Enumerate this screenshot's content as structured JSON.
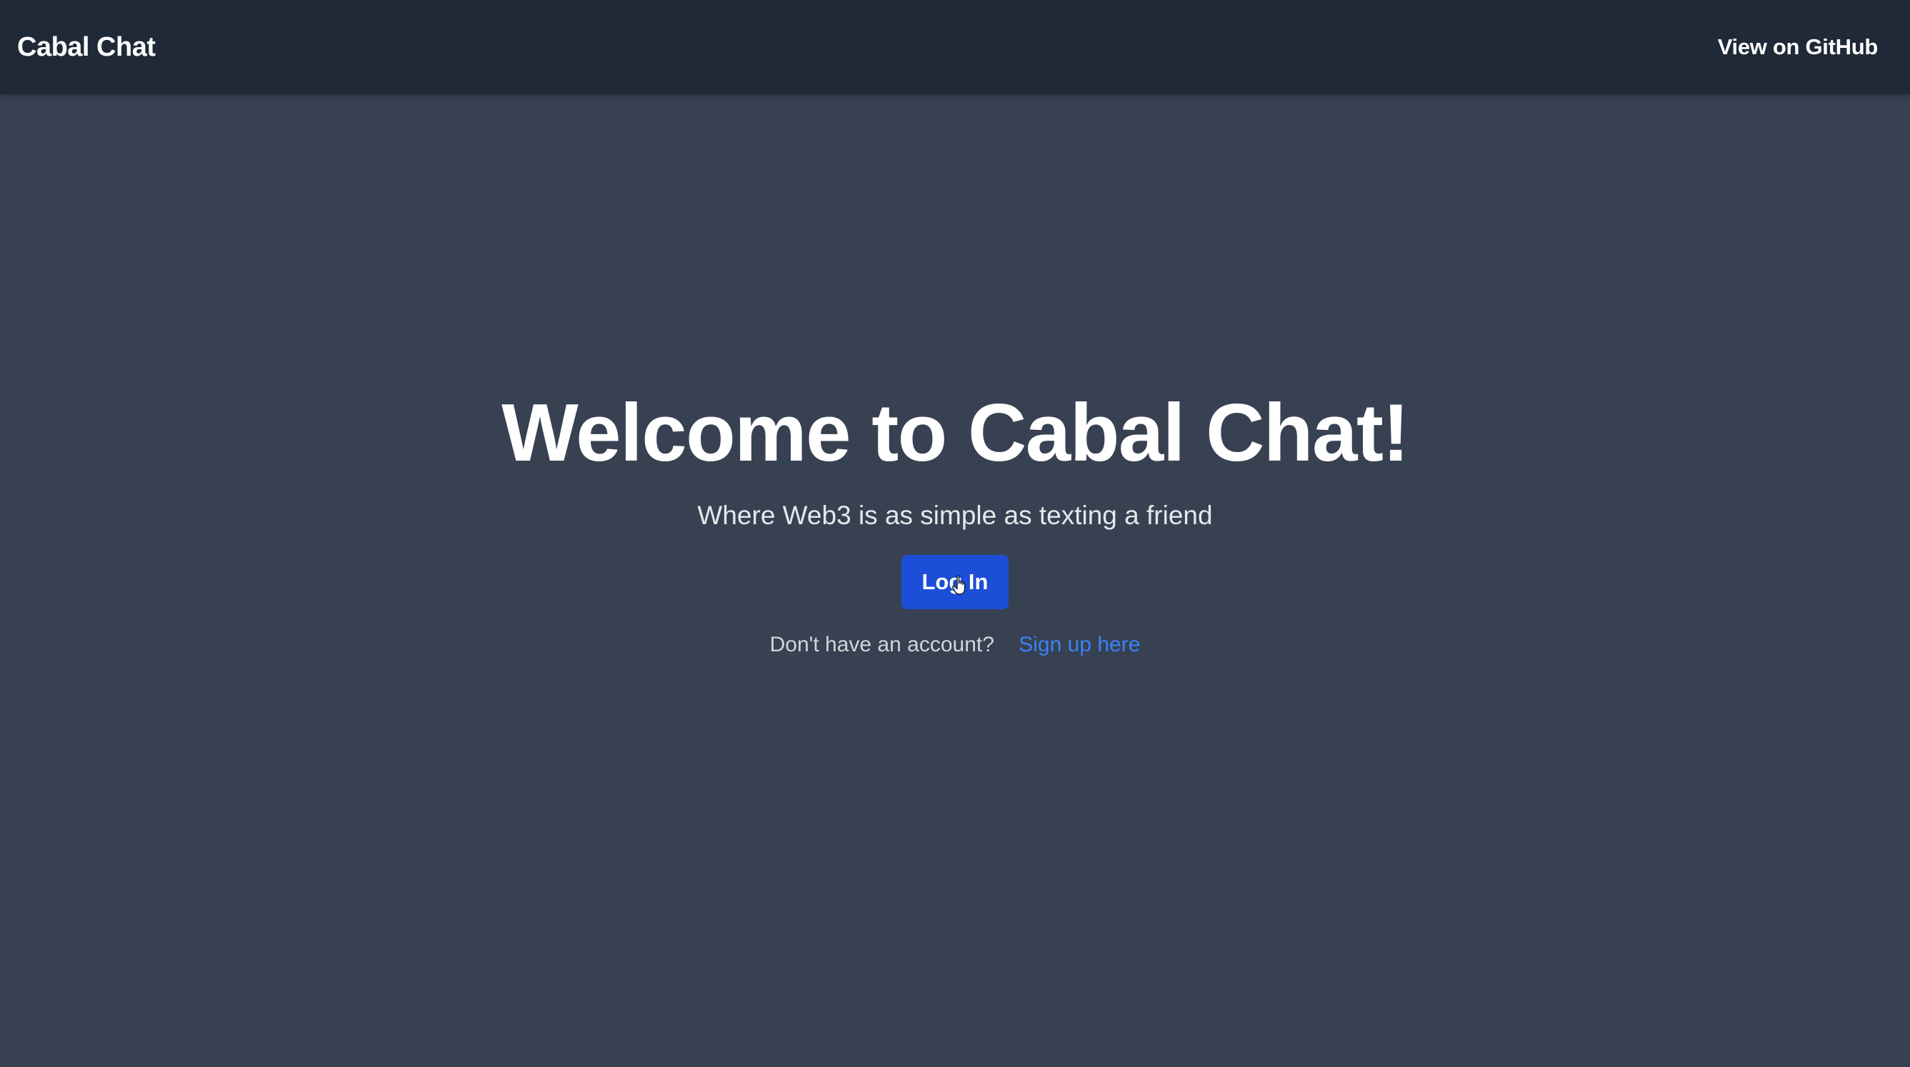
{
  "navbar": {
    "brand": "Cabal Chat",
    "github_link": "View on GitHub"
  },
  "hero": {
    "title": "Welcome to Cabal Chat!",
    "subtitle": "Where Web3 is as simple as texting a friend",
    "login_label": "Log In",
    "signup_prompt": "Don't have an account?",
    "signup_link": "Sign up here"
  },
  "colors": {
    "navbar_bg": "#1f2937",
    "page_bg": "#374151",
    "button_bg": "#1d4ed8",
    "link": "#3b82f6"
  },
  "icons": {
    "cursor": "hand-pointer-cursor"
  }
}
